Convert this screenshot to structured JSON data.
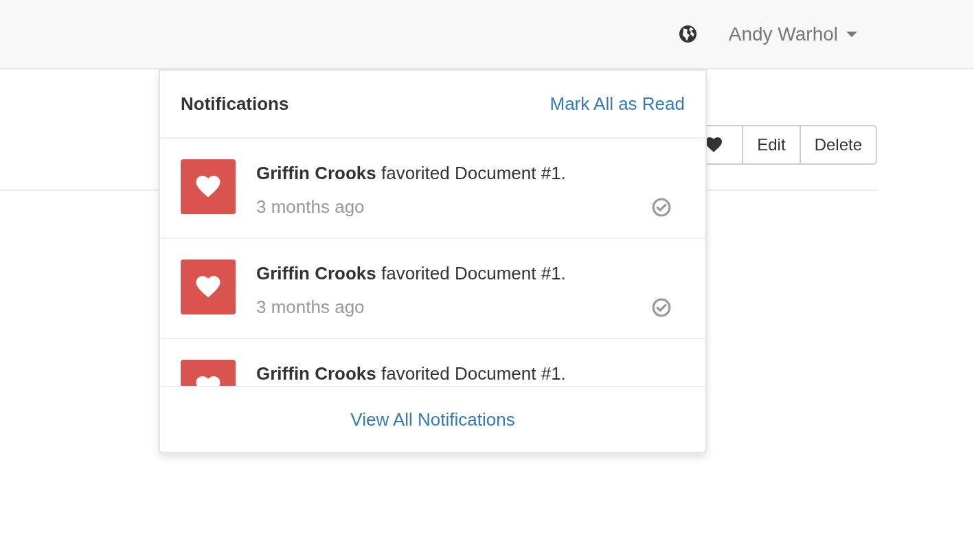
{
  "navbar": {
    "user_name": "Andy Warhol"
  },
  "toolbar": {
    "buttons": [
      {
        "kind": "icon"
      },
      {
        "kind": "text",
        "label": "Edit"
      },
      {
        "kind": "text",
        "label": "Delete"
      }
    ]
  },
  "notifications": {
    "title": "Notifications",
    "mark_all": "Mark All as Read",
    "footer": "View All Notifications",
    "items": [
      {
        "message": "**Griffin Crooks** favorited Document #1.",
        "time": "3 months ago"
      },
      {
        "message": "**Griffin Crooks** favorited Document #1.",
        "time": "3 months ago"
      },
      {
        "message": "**Griffin Crooks** favorited Document #1."
      }
    ]
  }
}
